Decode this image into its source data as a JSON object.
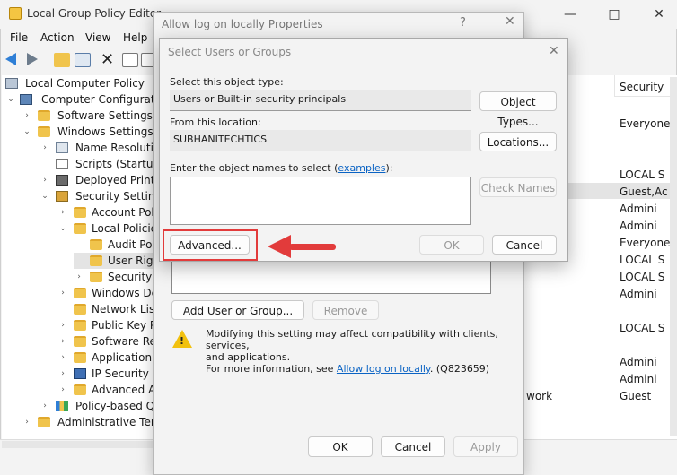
{
  "main": {
    "title": "Local Group Policy Editor",
    "menu": [
      "File",
      "Action",
      "View",
      "Help"
    ],
    "tree": [
      {
        "label": "Local Computer Policy"
      },
      {
        "label": "Computer Configuratio"
      },
      {
        "label": "Software Settings"
      },
      {
        "label": "Windows Settings"
      },
      {
        "label": "Name Resolution"
      },
      {
        "label": "Scripts (Startup/"
      },
      {
        "label": "Deployed Printer"
      },
      {
        "label": "Security Settings"
      },
      {
        "label": "Account Polic"
      },
      {
        "label": "Local Policies"
      },
      {
        "label": "Audit Poli"
      },
      {
        "label": "User Right"
      },
      {
        "label": "Security O"
      },
      {
        "label": "Windows De"
      },
      {
        "label": "Network List"
      },
      {
        "label": "Public Key P"
      },
      {
        "label": "Software Res"
      },
      {
        "label": "Application C"
      },
      {
        "label": "IP Security P"
      },
      {
        "label": "Advanced Au"
      },
      {
        "label": "Policy-based Qo"
      },
      {
        "label": "Administrative Temp"
      }
    ],
    "right_header": "Security",
    "right_values": [
      "Everyone",
      "LOCAL S",
      "Guest,Ac",
      "Admini",
      "Admini",
      "Everyone",
      "LOCAL S",
      "LOCAL S",
      "Admini",
      "LOCAL S",
      "Admini",
      "Admini",
      "Guest"
    ],
    "right_partial": "work"
  },
  "props": {
    "title": "Allow log on locally Properties",
    "help_glyph": "?",
    "add_button": "Add User or Group...",
    "remove_button": "Remove",
    "warning_line1": "Modifying this setting may affect compatibility with clients, services,",
    "warning_line2": "and applications.",
    "warning_more": "For more information, see",
    "warning_link": "Allow log on locally",
    "warning_code": ". (Q823659)",
    "ok": "OK",
    "cancel": "Cancel",
    "apply": "Apply"
  },
  "select": {
    "title": "Select Users or Groups",
    "object_type_label": "Select this object type:",
    "object_type_value": "Users or Built-in security principals",
    "object_types_button": "Object Types...",
    "location_label": "From this location:",
    "location_value": "SUBHANITECHTICS",
    "locations_button": "Locations...",
    "names_label": "Enter the object names to select (",
    "names_link": "examples",
    "names_label_end": "):",
    "check_names_button": "Check Names",
    "advanced_button": "Advanced...",
    "ok": "OK",
    "cancel": "Cancel"
  }
}
